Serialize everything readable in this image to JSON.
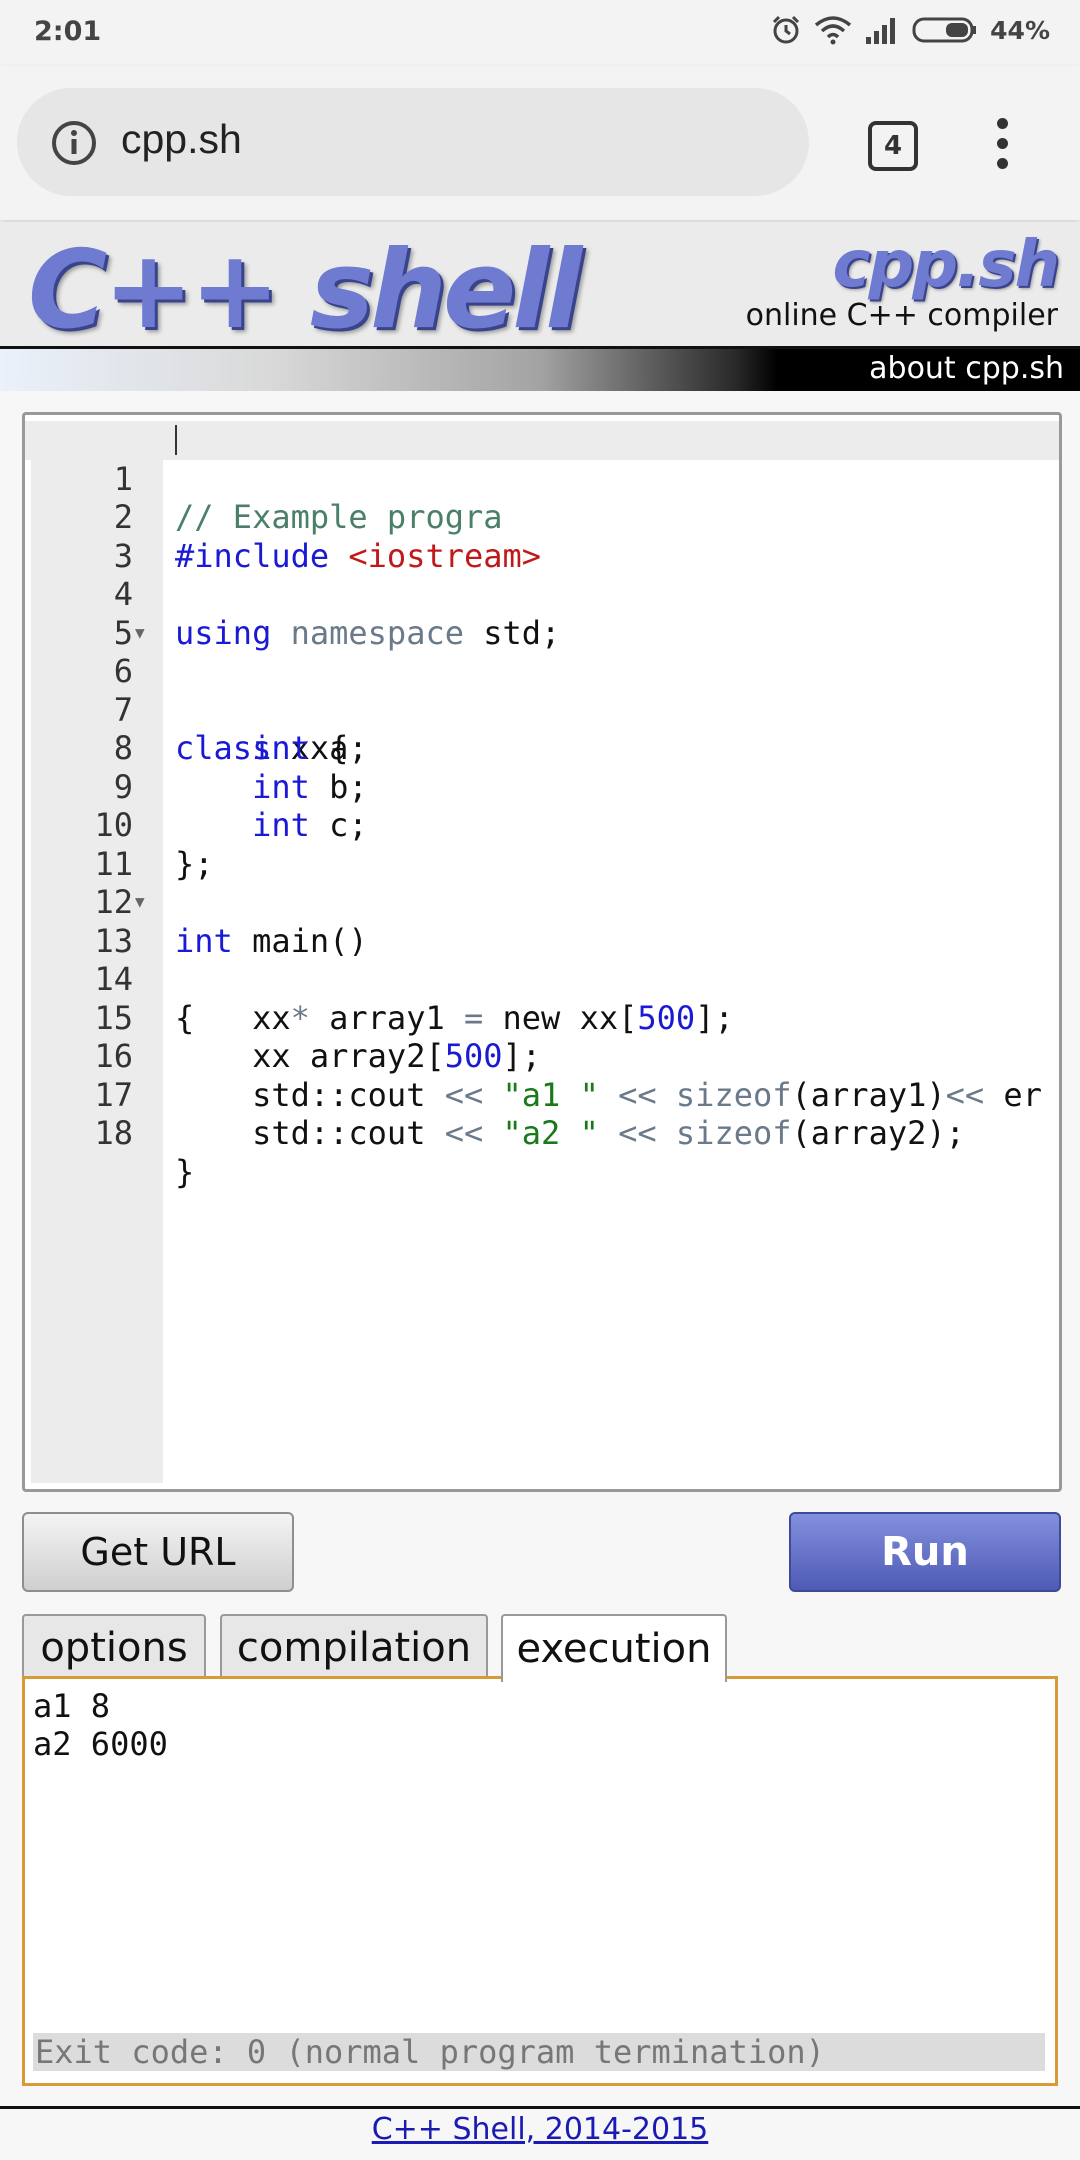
{
  "status": {
    "time": "2:01",
    "battery": "44%"
  },
  "browser": {
    "url": "cpp.sh",
    "tab_count": "4"
  },
  "header": {
    "logo_main": "C++ shell",
    "logo_side": "cpp.sh",
    "subtitle": "online C++ compiler",
    "about": "about cpp.sh"
  },
  "editor": {
    "lines": [
      {
        "num": "1",
        "text": "// Example progra"
      },
      {
        "num": "2",
        "text": "#include <iostream>"
      },
      {
        "num": "3",
        "text": ""
      },
      {
        "num": "4",
        "text": "using namespace std;"
      },
      {
        "num": "5",
        "text": ""
      },
      {
        "num": "6",
        "text": "class xx{"
      },
      {
        "num": "7",
        "text": "    int a;"
      },
      {
        "num": "8",
        "text": "    int b;"
      },
      {
        "num": "9",
        "text": "    int c;"
      },
      {
        "num": "10",
        "text": "};"
      },
      {
        "num": "11",
        "text": ""
      },
      {
        "num": "12",
        "text": "int main()"
      },
      {
        "num": "13",
        "text": "{"
      },
      {
        "num": "14",
        "text": "    xx* array1 = new xx[500];"
      },
      {
        "num": "15",
        "text": "    xx array2[500];"
      },
      {
        "num": "16",
        "text": "    std::cout << \"a1 \" << sizeof(array1)<< er"
      },
      {
        "num": "17",
        "text": "    std::cout << \"a2 \" << sizeof(array2);"
      },
      {
        "num": "18",
        "text": "}"
      }
    ]
  },
  "buttons": {
    "get_url": "Get URL",
    "run": "Run"
  },
  "tabs": [
    "options",
    "compilation",
    "execution"
  ],
  "output": {
    "lines": [
      "a1 8",
      "a2 6000"
    ],
    "exit": "Exit code: 0 (normal program termination)"
  },
  "footer": {
    "link": "C++ Shell, 2014-2015"
  }
}
